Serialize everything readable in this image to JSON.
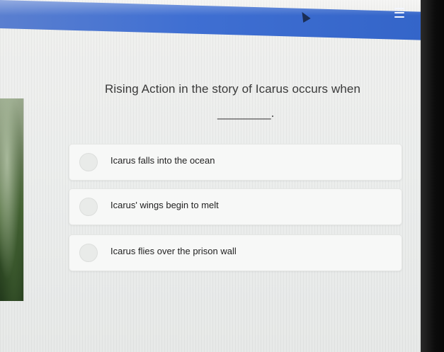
{
  "header": {
    "menu_icon": "hamburger-menu-icon",
    "color": "#3f6fd2"
  },
  "question": {
    "text": "Rising Action in the story of Icarus occurs when",
    "blank": "________."
  },
  "options": [
    {
      "label": "Icarus falls into the ocean"
    },
    {
      "label": "Icarus' wings begin to melt"
    },
    {
      "label": "Icarus flies over the prison wall"
    }
  ]
}
